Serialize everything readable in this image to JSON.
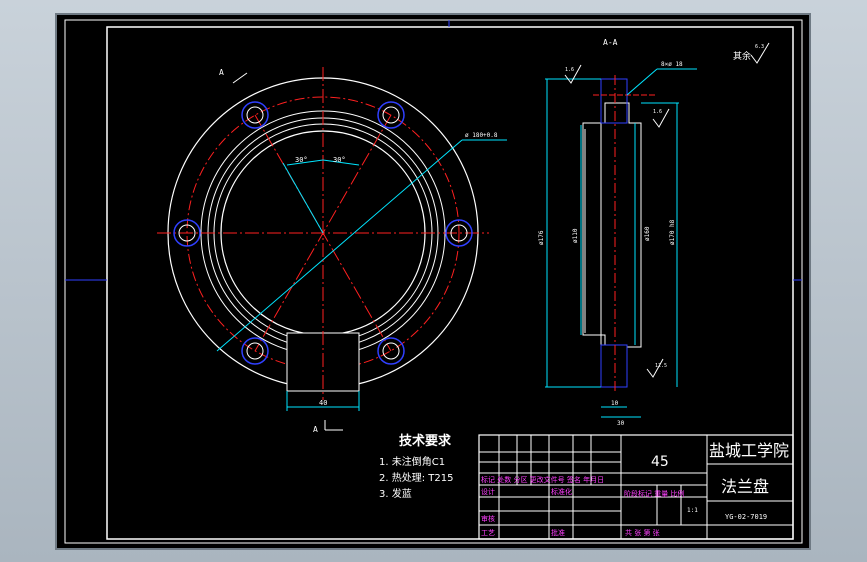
{
  "colors": {
    "background": "#000000",
    "outline": "#ffffff",
    "center_line": "#ff2020",
    "dimension": "#00e5ff",
    "hidden": "#ff2020",
    "hole_ring": "#3040ff",
    "title_text": "#ffffff",
    "header_text": "#ff40ff",
    "notes_text": "#ffffff"
  },
  "section_label": "A-A",
  "cut_label": "A",
  "dimensions": {
    "bolt_circle": "ø 180+0.8",
    "slot_width": "40",
    "angle_left": "30°",
    "angle_right": "30°",
    "dia_outer": "ø176",
    "dia_inner_1": "ø110",
    "dia_inner_2": "ø160",
    "dia_bore": "ø170 h8",
    "thk_1": "10",
    "thk_2": "30",
    "hole_note": "8×ø 18",
    "roughness_1": "1.6",
    "roughness_2": "1.6",
    "roughness_3": "12.5",
    "roughness_other": "6.3",
    "other_label": "其余"
  },
  "notes": {
    "title": "技术要求",
    "items": [
      "1. 未注倒角C1",
      "2. 热处理: T215",
      "3. 发蓝"
    ]
  },
  "title_block": {
    "material": "45",
    "school": "盐城工学院",
    "part_name": "法兰盘",
    "drawing_no": "YG-02-7019",
    "scale": "1:1",
    "header_row": "标记 处数 分区 更改文件号 签名 年月日",
    "designer": "设计",
    "standardization": "标准化",
    "stage_mark": "阶段标记 重量 比例",
    "reviewer": "审核",
    "process": "工艺",
    "approval": "批准",
    "sheets": "共  张  第  张"
  }
}
